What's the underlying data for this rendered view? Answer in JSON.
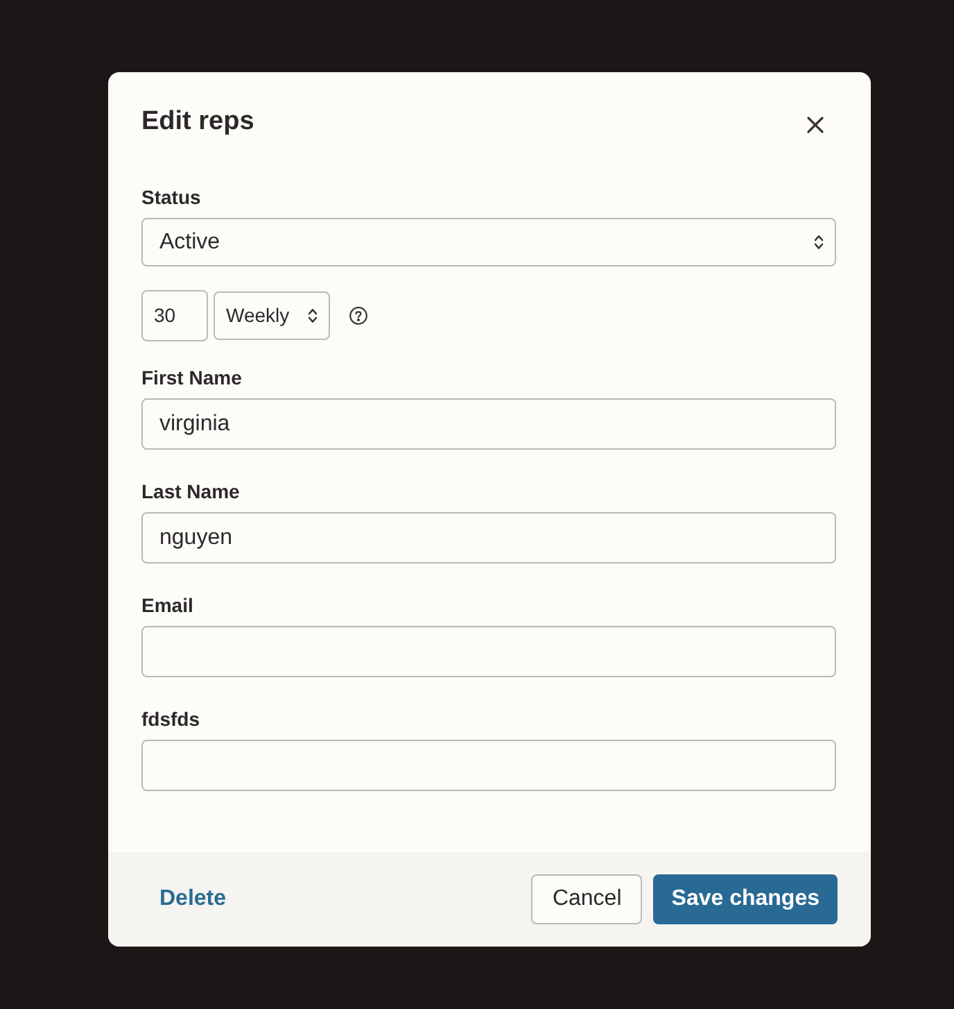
{
  "dialog": {
    "title": "Edit reps"
  },
  "status": {
    "label": "Status",
    "value": "Active"
  },
  "frequency": {
    "count": "30",
    "period": "Weekly"
  },
  "fields": [
    {
      "label": "First Name",
      "value": "virginia"
    },
    {
      "label": "Last Name",
      "value": "nguyen"
    },
    {
      "label": "Email"
    },
    {
      "label": "fdsfds"
    }
  ],
  "footer": {
    "delete": "Delete",
    "cancel": "Cancel",
    "save": "Save changes"
  }
}
